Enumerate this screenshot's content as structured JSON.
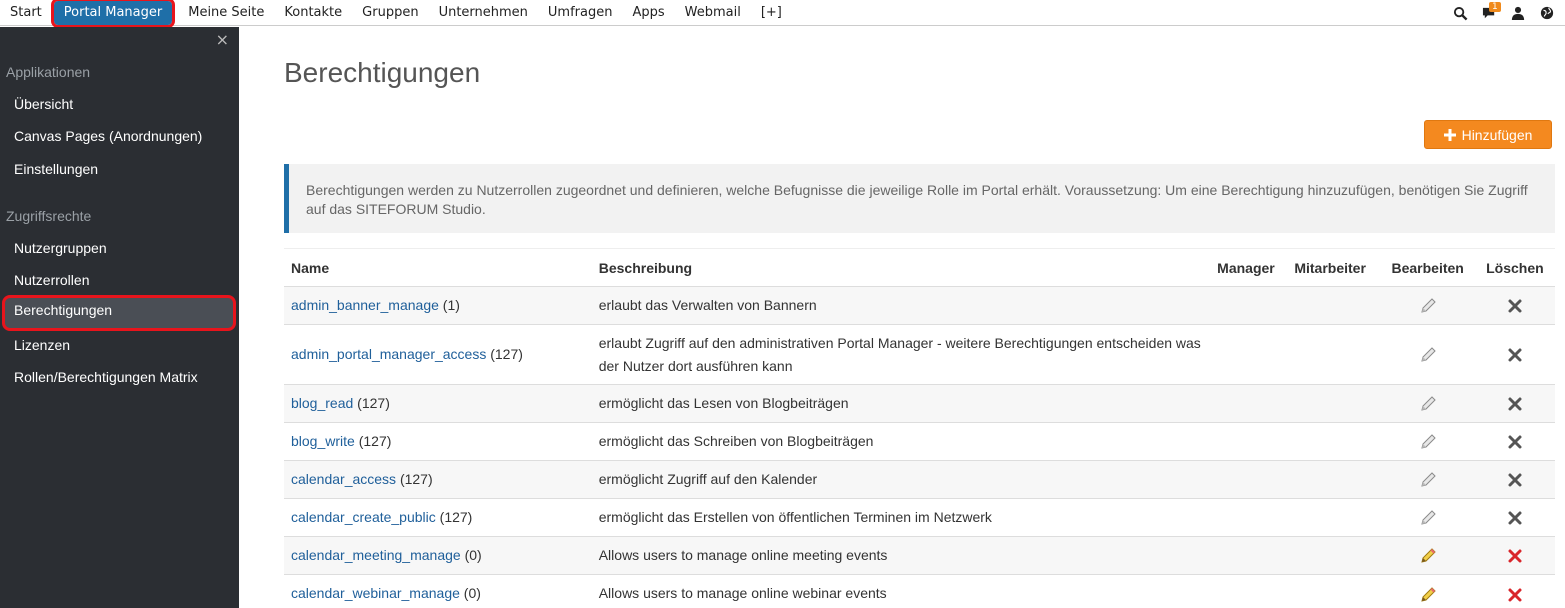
{
  "topnav": {
    "items": [
      "Start",
      "Portal Manager",
      "Meine Seite",
      "Kontakte",
      "Gruppen",
      "Unternehmen",
      "Umfragen",
      "Apps",
      "Webmail",
      "[+]"
    ],
    "active": "Portal Manager",
    "notification_count": "1"
  },
  "sidebar": {
    "close_label": "×",
    "heading_apps": "Applikationen",
    "apps_items": [
      "Übersicht",
      "Canvas Pages (Anordnungen)",
      "Einstellungen"
    ],
    "heading_access": "Zugriffsrechte",
    "access_items": [
      "Nutzergruppen",
      "Nutzerrollen",
      "Berechtigungen",
      "Lizenzen",
      "Rollen/Berechtigungen Matrix"
    ],
    "active": "Berechtigungen"
  },
  "main": {
    "title": "Berechtigungen",
    "add_button": "Hinzufügen",
    "info": "Berechtigungen werden zu Nutzerrollen zugeordnet und definieren, welche Befugnisse die jeweilige Rolle im Portal erhält. Voraussetzung: Um eine Berechtigung hinzuzufügen, benötigen Sie Zugriff auf das SITEFORUM Studio.",
    "columns": [
      "Name",
      "Beschreibung",
      "Manager",
      "Mitarbeiter",
      "Bearbeiten",
      "Löschen"
    ],
    "rows": [
      {
        "name": "admin_banner_manage",
        "count": " (1)",
        "desc": "erlaubt das Verwalten von Bannern",
        "editable": false
      },
      {
        "name": "admin_portal_manager_access",
        "count": " (127)",
        "desc": "erlaubt Zugriff auf den administrativen Portal Manager - weitere Berechtigungen entscheiden was der Nutzer dort ausführen kann",
        "editable": false
      },
      {
        "name": "blog_read",
        "count": " (127)",
        "desc": "ermöglicht das Lesen von Blogbeiträgen",
        "editable": false
      },
      {
        "name": "blog_write",
        "count": " (127)",
        "desc": "ermöglicht das Schreiben von Blogbeiträgen",
        "editable": false
      },
      {
        "name": "calendar_access",
        "count": " (127)",
        "desc": "ermöglicht Zugriff auf den Kalender",
        "editable": false
      },
      {
        "name": "calendar_create_public",
        "count": " (127)",
        "desc": "ermöglicht das Erstellen von öffentlichen Terminen im Netzwerk",
        "editable": false
      },
      {
        "name": "calendar_meeting_manage",
        "count": " (0)",
        "desc": "Allows users to manage online meeting events",
        "editable": true
      },
      {
        "name": "calendar_webinar_manage",
        "count": " (0)",
        "desc": "Allows users to manage online webinar events",
        "editable": true
      }
    ]
  },
  "colors": {
    "accent_blue": "#1f6fa8",
    "add_orange": "#f4891f",
    "sidebar_bg": "#2b2e33",
    "delete_red": "#d9262b"
  }
}
